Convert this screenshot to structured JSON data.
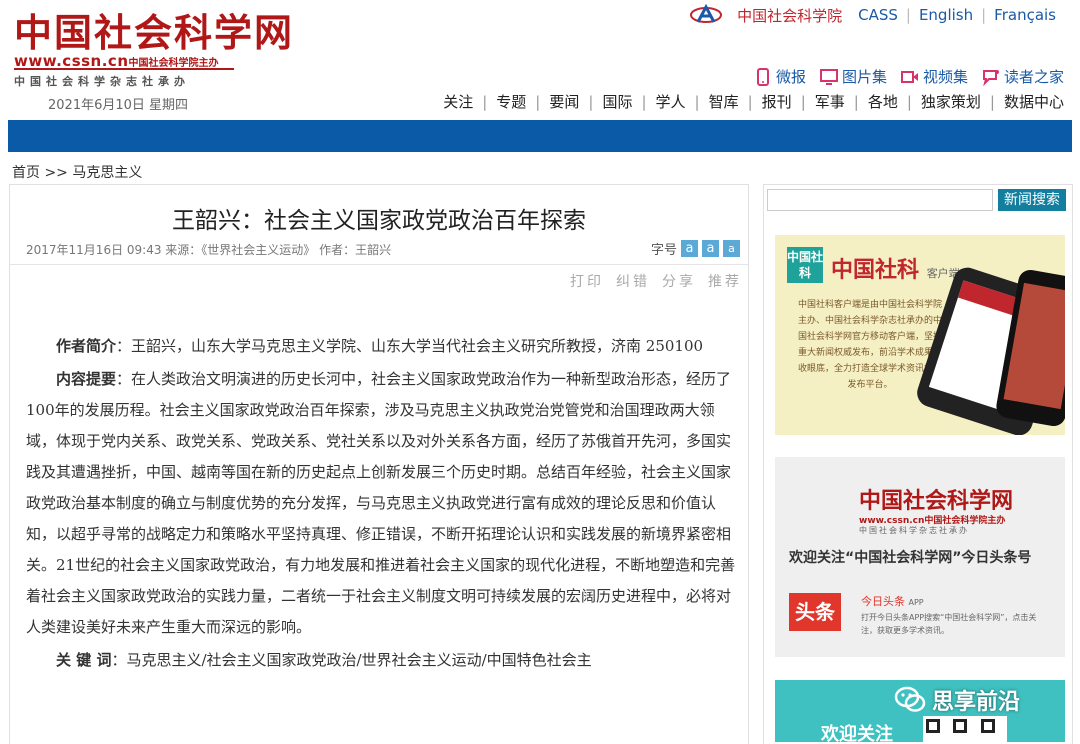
{
  "site": {
    "logo_cn": "中国社会科学网",
    "logo_url": "www.cssn.cn",
    "logo_url_suffix": "中国社会科学院主办",
    "logo_sub": "中国社会科学杂志社承办",
    "date": "2021年6月10日  星期四"
  },
  "top_links": {
    "cass_cn": "中国社会科学院",
    "cass": "CASS",
    "english": "English",
    "french": "Français"
  },
  "mid_links": [
    {
      "label": "微报",
      "icon": "phone-icon"
    },
    {
      "label": "图片集",
      "icon": "monitor-icon"
    },
    {
      "label": "视频集",
      "icon": "video-icon"
    },
    {
      "label": "读者之家",
      "icon": "chat-icon"
    }
  ],
  "nav": [
    "关注",
    "专题",
    "要闻",
    "国际",
    "学人",
    "智库",
    "报刊",
    "军事",
    "各地",
    "独家策划",
    "数据中心"
  ],
  "colors": {
    "brand_red": "#b01818",
    "nav_blue": "#0a5aa8",
    "search_button": "#137e9e"
  },
  "breadcrumb": "首页 >> 马克思主义",
  "article": {
    "title": "王韶兴：社会主义国家政党政治百年探索",
    "meta": "2017年11月16日 09:43 来源：《世界社会主义运动》 作者：王韶兴",
    "fontsize_label": "字号",
    "fontsize_buttons": [
      "a",
      "a",
      "a"
    ],
    "tools": [
      "打印",
      "纠错",
      "分享",
      "推荐"
    ],
    "author_label": "作者简介",
    "author_text": "：王韶兴，山东大学马克思主义学院、山东大学当代社会主义研究所教授，济南 250100",
    "abstract_label": "内容提要",
    "abstract_text": "：在人类政治文明演进的历史长河中，社会主义国家政党政治作为一种新型政治形态，经历了100年的发展历程。社会主义国家政党政治百年探索，涉及马克思主义执政党治党管党和治国理政两大领域，体现于党内关系、政党关系、党政关系、党社关系以及对外关系各方面，经历了苏俄首开先河，多国实践及其遭遇挫折，中国、越南等国在新的历史起点上创新发展三个历史时期。总结百年经验，社会主义国家政党政治基本制度的确立与制度优势的充分发挥，与马克思主义执政党进行富有成效的理论反思和价值认知，以超乎寻常的战略定力和策略水平坚持真理、修正错误，不断开拓理论认识和实践发展的新境界紧密相关。21世纪的社会主义国家政党政治，有力地发展和推进着社会主义国家的现代化进程，不断地塑造和完善着社会主义国家政党政治的实践力量，二者统一于社会主义制度文明可持续发展的宏阔历史进程中，必将对人类建设美好未来产生重大而深远的影响。",
    "keywords_label": "关 键 词",
    "keywords_text": "：马克思主义/社会主义国家政党政治/世界社会主义运动/中国特色社会主"
  },
  "sidebar": {
    "search_placeholder": "",
    "search_button": "新闻搜索",
    "ad1": {
      "icon_text": "中国社科",
      "title": "中国社科",
      "title_suffix": "客户端",
      "desc": "中国社科客户端是由中国社会科学院主办、中国社会科学杂志社承办的中国社会科学网官方移动客户端，坚持重大新闻权威发布，前沿学术成果尽收眼底，全力打造全球学术资讯权威发布平台。"
    },
    "ad2": {
      "logo": "中国社会科学网",
      "url": "www.cssn.cn中国社会科学院主办",
      "sub": "中国社会科学杂志社承办",
      "headline": "欢迎关注“中国社会科学网”今日头条号",
      "tt_logo": "头条",
      "tt_name": "今日头条",
      "tt_app": "APP",
      "tt_desc": "打开今日头条APP搜索“中国社会科学网”，点击关注，获取更多学术资讯。"
    },
    "ad3": {
      "welcome": "欢迎关注"
    }
  },
  "watermark": "思享前沿"
}
